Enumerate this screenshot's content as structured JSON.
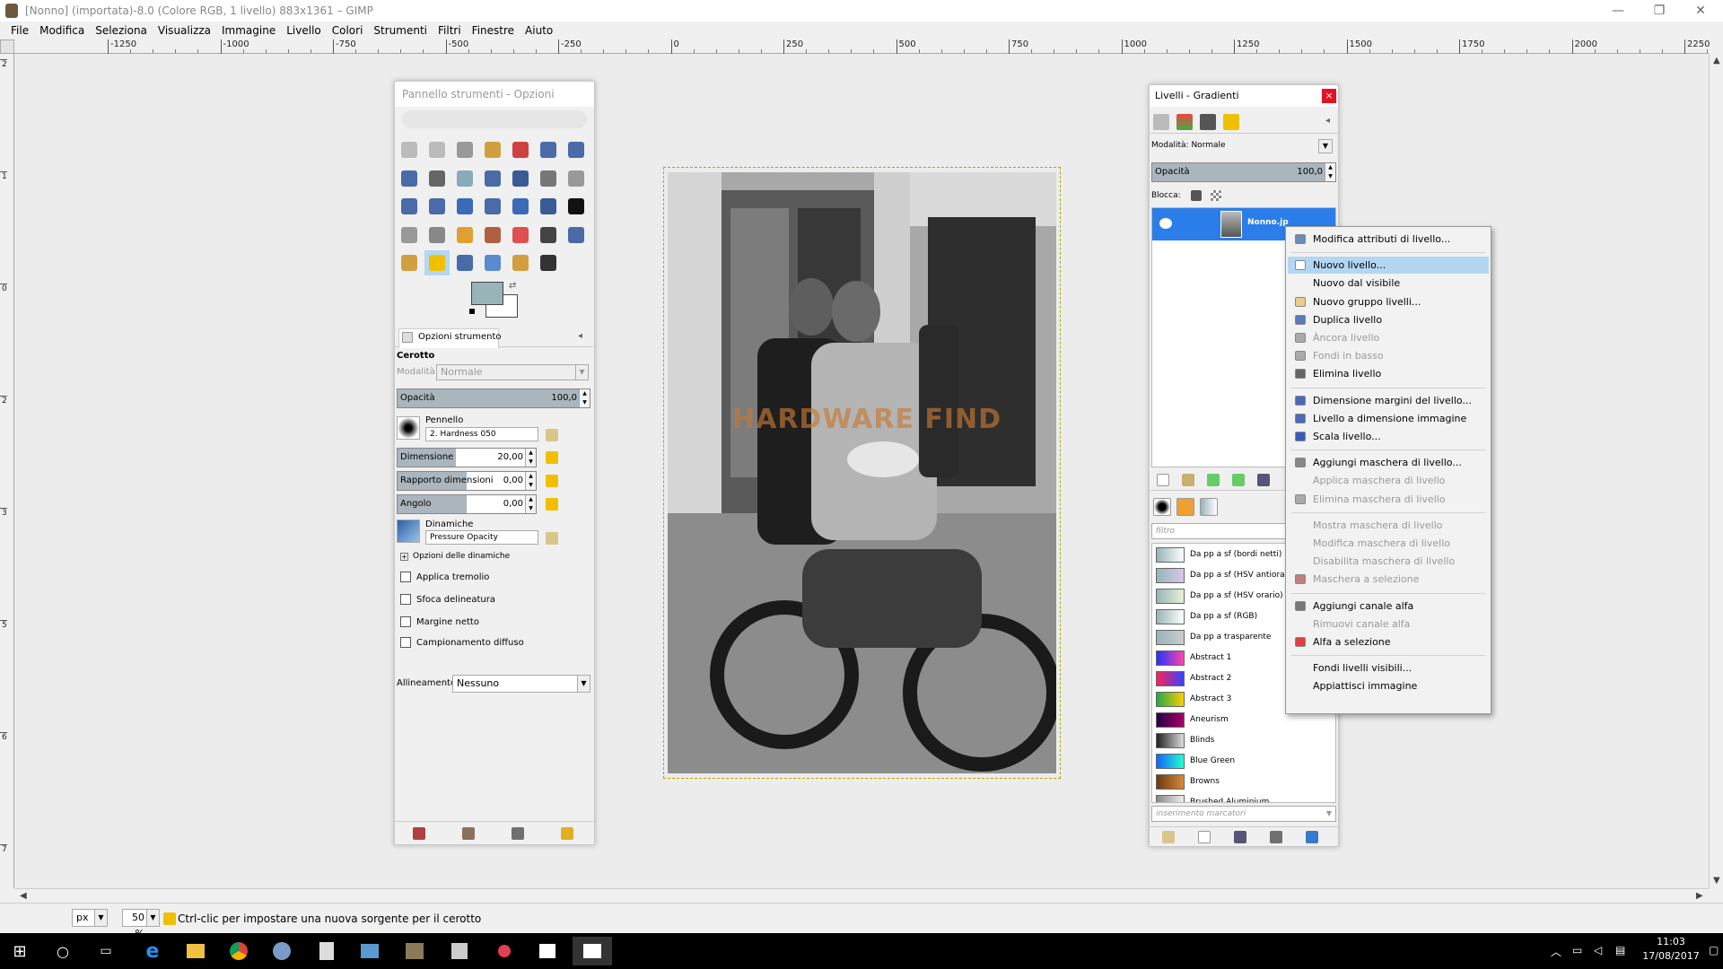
{
  "window": {
    "title": "[Nonno] (importata)-8.0 (Colore RGB, 1 livello) 883x1361 – GIMP"
  },
  "window_controls": {
    "minimize": "—",
    "maximize": "❐",
    "close": "✕"
  },
  "menu": [
    "File",
    "Modifica",
    "Seleziona",
    "Visualizza",
    "Immagine",
    "Livello",
    "Colori",
    "Strumenti",
    "Filtri",
    "Finestre",
    "Aiuto"
  ],
  "ruler_top": [
    "-1250",
    "-1000",
    "-750",
    "-500",
    "-250",
    "0",
    "250",
    "500",
    "750",
    "1000",
    "1250",
    "1500",
    "1750",
    "2000",
    "2250"
  ],
  "ruler_left": [
    "2",
    "1",
    "0",
    "2",
    "3",
    "5",
    "6",
    "7"
  ],
  "toolbox": {
    "title": "Pannello strumenti - Opzioni strum...",
    "tab_label": "Opzioni strumento",
    "tool_name": "Cerotto",
    "mode_label": "Modalità:",
    "mode_value": "Normale",
    "opacity": {
      "label": "Opacità",
      "value": "100,0",
      "fraction": 1.0
    },
    "brush_label": "Pennello",
    "brush_value": "2. Hardness 050",
    "size": {
      "label": "Dimensione",
      "value": "20,00",
      "fraction": 0.42
    },
    "aspect": {
      "label": "Rapporto dimensioni",
      "value": "0,00",
      "fraction": 0.5
    },
    "angle": {
      "label": "Angolo",
      "value": "0,00",
      "fraction": 0.5
    },
    "dynamics_label": "Dinamiche",
    "dynamics_value": "Pressure Opacity",
    "dynamics_options": "Opzioni delle dinamiche",
    "checks": [
      "Applica tremolio",
      "Sfoca delineatura",
      "Margine netto",
      "Campionamento diffuso"
    ],
    "alignment_label": "Allineamento:",
    "alignment_value": "Nessuno",
    "fg_color": "#98b4b8",
    "bg_color": "#ffffff"
  },
  "image": {
    "watermark": "HARDWARE FIND"
  },
  "layers": {
    "title": "Livelli - Gradienti",
    "close": "×",
    "mode_label": "Modalità:",
    "mode_value": "Normale",
    "opacity_label": "Opacità",
    "opacity_value": "100,0",
    "lock_label": "Blocca:",
    "layer_name": "Nonno.jp",
    "filter_placeholder": "filtro",
    "tags_placeholder": "inserimento marcatori",
    "gradients": [
      {
        "name": "Da pp a sf (bordi netti)",
        "c1": "#98b4b8",
        "c2": "#ffffff"
      },
      {
        "name": "Da pp a sf (HSV antiorario)",
        "c1": "#98b4b8",
        "c2": "#d8c8e8"
      },
      {
        "name": "Da pp a sf (HSV orario)",
        "c1": "#98b4b8",
        "c2": "#e8f0d8"
      },
      {
        "name": "Da pp a sf (RGB)",
        "c1": "#98b4b8",
        "c2": "#ffffff"
      },
      {
        "name": "Da pp a trasparente",
        "c1": "#98b4b8",
        "c2": "#cccccc"
      },
      {
        "name": "Abstract 1",
        "c1": "#2233ff",
        "c2": "#ff44aa"
      },
      {
        "name": "Abstract 2",
        "c1": "#ff2255",
        "c2": "#3344ff"
      },
      {
        "name": "Abstract 3",
        "c1": "#22aa44",
        "c2": "#ffcc00"
      },
      {
        "name": "Aneurism",
        "c1": "#220044",
        "c2": "#aa0066"
      },
      {
        "name": "Blinds",
        "c1": "#222222",
        "c2": "#dddddd"
      },
      {
        "name": "Blue Green",
        "c1": "#1166ff",
        "c2": "#22ffcc"
      },
      {
        "name": "Browns",
        "c1": "#6b3a12",
        "c2": "#d88a3a"
      },
      {
        "name": "Brushed Aluminium",
        "c1": "#888888",
        "c2": "#eeeeee"
      }
    ]
  },
  "context_menu": [
    {
      "label": "Modifica attributi di livello...",
      "icon": "#6a8ab8",
      "disabled": false,
      "hl": false
    },
    {
      "sep": true
    },
    {
      "label": "Nuovo livello...",
      "icon": "#ffffff",
      "disabled": false,
      "hl": true
    },
    {
      "label": "Nuovo dal visibile",
      "icon": "",
      "disabled": false,
      "hl": false
    },
    {
      "label": "Nuovo gruppo livelli...",
      "icon": "#e8d088",
      "disabled": false,
      "hl": false
    },
    {
      "label": "Duplica livello",
      "icon": "#5a7ab8",
      "disabled": false,
      "hl": false
    },
    {
      "label": "Àncora livello",
      "icon": "#aaaaaa",
      "disabled": true,
      "hl": false
    },
    {
      "label": "Fondi in basso",
      "icon": "#aaaaaa",
      "disabled": true,
      "hl": false
    },
    {
      "label": "Elimina livello",
      "icon": "#666666",
      "disabled": false,
      "hl": false
    },
    {
      "sep": true
    },
    {
      "label": "Dimensione margini del livello...",
      "icon": "#4a6ab8",
      "disabled": false,
      "hl": false
    },
    {
      "label": "Livello a dimensione immagine",
      "icon": "#4a6ab8",
      "disabled": false,
      "hl": false
    },
    {
      "label": "Scala livello...",
      "icon": "#3a5ab8",
      "disabled": false,
      "hl": false
    },
    {
      "sep": true
    },
    {
      "label": "Aggiungi maschera di livello...",
      "icon": "#888888",
      "disabled": false,
      "hl": false
    },
    {
      "label": "Applica maschera di livello",
      "icon": "",
      "disabled": true,
      "hl": false
    },
    {
      "label": "Elimina maschera di livello",
      "icon": "#aaaaaa",
      "disabled": true,
      "hl": false
    },
    {
      "sep": true
    },
    {
      "label": "Mostra maschera di livello",
      "icon": "",
      "disabled": true,
      "hl": false
    },
    {
      "label": "Modifica maschera di livello",
      "icon": "",
      "disabled": true,
      "hl": false
    },
    {
      "label": "Disabilita maschera di livello",
      "icon": "",
      "disabled": true,
      "hl": false
    },
    {
      "label": "Maschera a selezione",
      "icon": "#c08080",
      "disabled": true,
      "hl": false
    },
    {
      "sep": true
    },
    {
      "label": "Aggiungi canale alfa",
      "icon": "#777777",
      "disabled": false,
      "hl": false
    },
    {
      "label": "Rimuovi canale alfa",
      "icon": "",
      "disabled": true,
      "hl": false
    },
    {
      "label": "Alfa a selezione",
      "icon": "#e04040",
      "disabled": false,
      "hl": false
    },
    {
      "sep": true
    },
    {
      "label": "Fondi livelli visibili...",
      "icon": "",
      "disabled": false,
      "hl": false
    },
    {
      "label": "Appiattisci immagine",
      "icon": "",
      "disabled": false,
      "hl": false
    }
  ],
  "status": {
    "unit": "px",
    "zoom": "50 %",
    "message": "Ctrl-clic per impostare una nuova sorgente per il cerotto"
  },
  "taskbar": {
    "time": "11:03",
    "date": "17/08/2017"
  }
}
